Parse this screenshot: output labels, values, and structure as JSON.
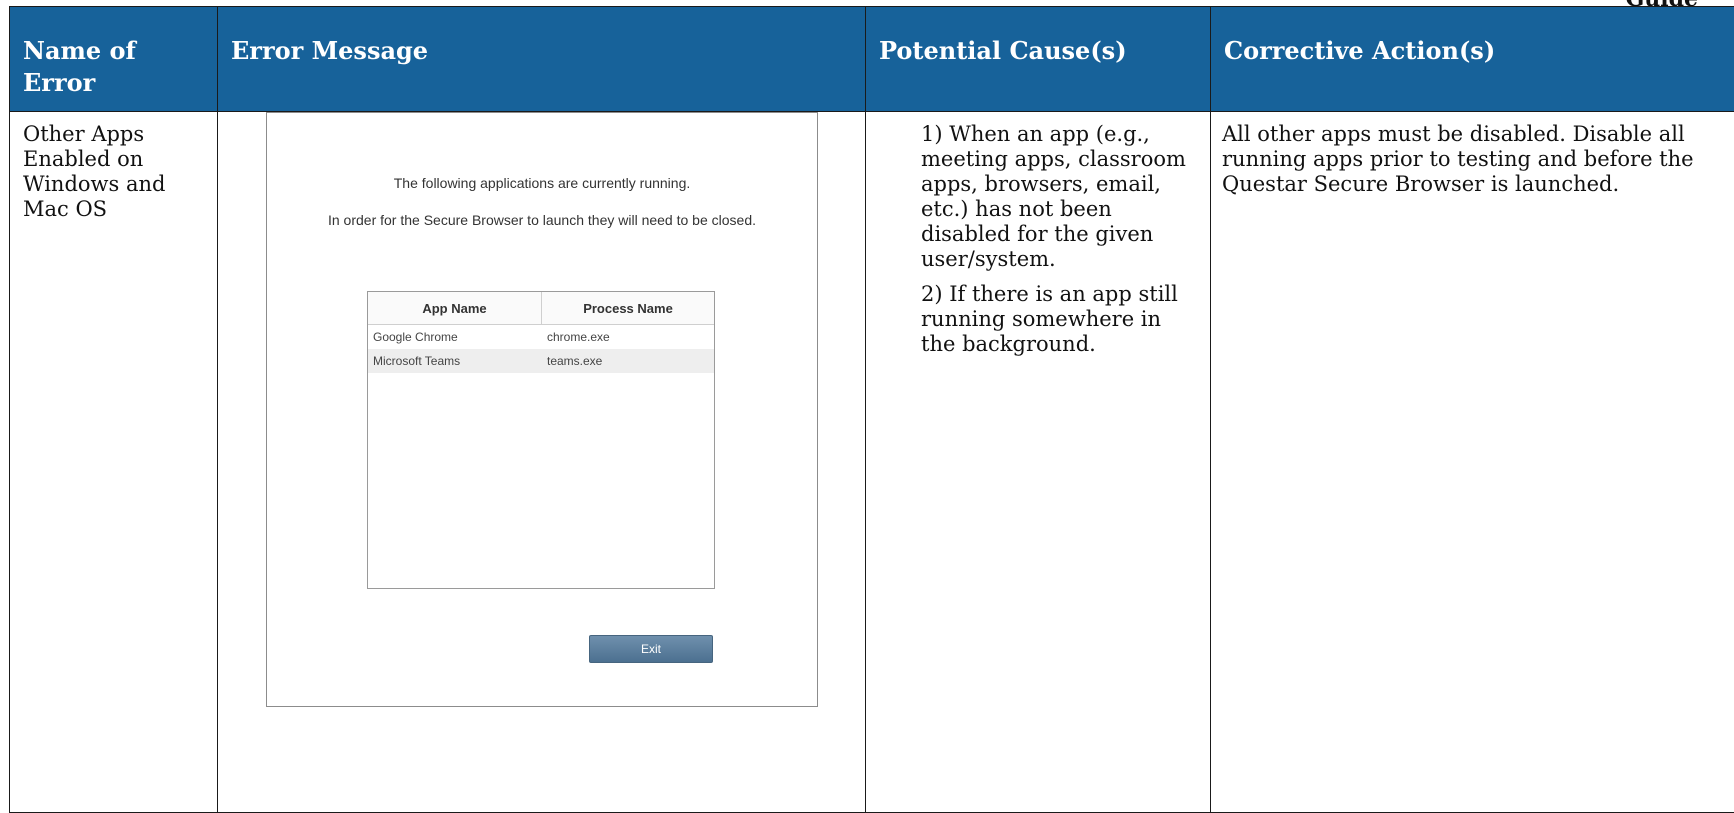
{
  "page_fragment": "Guide",
  "table": {
    "headers": [
      "Name of Error",
      "Error Message",
      "Potential Cause(s)",
      "Corrective Action(s)"
    ],
    "row": {
      "name": "Other Apps Enabled on Windows and Mac OS",
      "causes": [
        "1) When an app (e.g., meeting apps, classroom apps, browsers, email, etc.) has not been disabled for the given user/system.",
        "2) If there is an app still running somewhere in the background."
      ],
      "action": "All other apps must be disabled. Disable all running apps prior to testing and before the Questar Secure Browser is launched."
    }
  },
  "dialog": {
    "line1": "The following applications are currently running.",
    "line2": "In order for the Secure Browser to launch they will need to be closed.",
    "columns": [
      "App Name",
      "Process Name"
    ],
    "apps": [
      {
        "app": "Google Chrome",
        "process": "chrome.exe"
      },
      {
        "app": "Microsoft Teams",
        "process": "teams.exe"
      }
    ],
    "exit_label": "Exit"
  },
  "colors": {
    "header_bg": "#17629a",
    "header_text": "#ffffff"
  }
}
